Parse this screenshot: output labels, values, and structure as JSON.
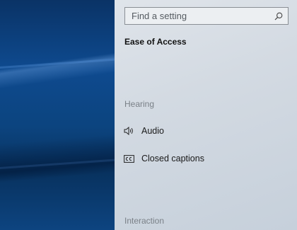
{
  "search": {
    "placeholder": "Find a setting",
    "icon": "search-icon"
  },
  "page_title": "Ease of Access",
  "sections": [
    {
      "label": "Hearing",
      "items": [
        {
          "label": "Audio",
          "icon": "speaker-icon"
        },
        {
          "label": "Closed captions",
          "icon": "closed-captions-icon"
        }
      ]
    },
    {
      "label": "Interaction",
      "items": []
    }
  ]
}
